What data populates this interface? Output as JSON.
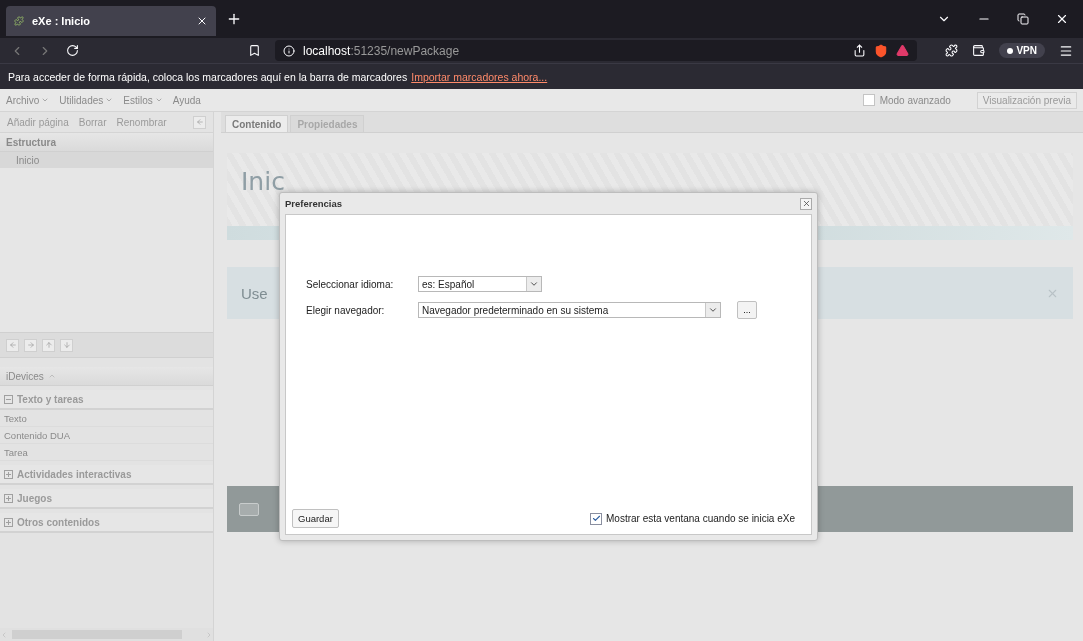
{
  "browser": {
    "tab_title": "eXe : Inicio",
    "url_host": "localhost",
    "url_path": ":51235/newPackage",
    "vpn_label": "VPN",
    "bookmarks_message": "Para acceder de forma rápida, coloca los marcadores aquí en la barra de marcadores",
    "bookmarks_link": "Importar marcadores ahora..."
  },
  "menu": [
    {
      "label": "Archivo",
      "dropdown": true
    },
    {
      "label": "Utilidades",
      "dropdown": true
    },
    {
      "label": "Estilos",
      "dropdown": true
    },
    {
      "label": "Ayuda",
      "dropdown": false
    }
  ],
  "advanced_mode": {
    "label": "Modo avanzado",
    "checked": false
  },
  "preview_button": "Visualización previa",
  "outline_toolbar": [
    "Añadir página",
    "Borrar",
    "Renombrar"
  ],
  "structure": {
    "header": "Estructura",
    "nodes": [
      {
        "label": "Inicio",
        "selected": true
      }
    ]
  },
  "idevices": {
    "header": "iDevices",
    "categories": [
      {
        "label": "Texto y tareas",
        "expanded": true,
        "children": [
          "Texto",
          "Contenido DUA",
          "Tarea"
        ]
      },
      {
        "label": "Actividades interactivas",
        "expanded": false
      },
      {
        "label": "Juegos",
        "expanded": false
      },
      {
        "label": "Otros contenidos",
        "expanded": false
      }
    ]
  },
  "tabs": [
    {
      "label": "Contenido",
      "selected": true
    },
    {
      "label": "Propiedades",
      "selected": false
    }
  ],
  "page": {
    "title": "Inic",
    "info_text": "Use"
  },
  "dialog": {
    "title": "Preferencias",
    "fields": [
      {
        "kind": "select",
        "label": "Seleccionar idioma:",
        "value": "es: Español"
      },
      {
        "kind": "select",
        "label": "Elegir navegador:",
        "value": "Navegador predeterminado en su sistema",
        "browse": "..."
      }
    ],
    "save_button": "Guardar",
    "show_on_start": {
      "label": "Mostrar esta ventana cuando se inicia eXe",
      "checked": true
    }
  }
}
